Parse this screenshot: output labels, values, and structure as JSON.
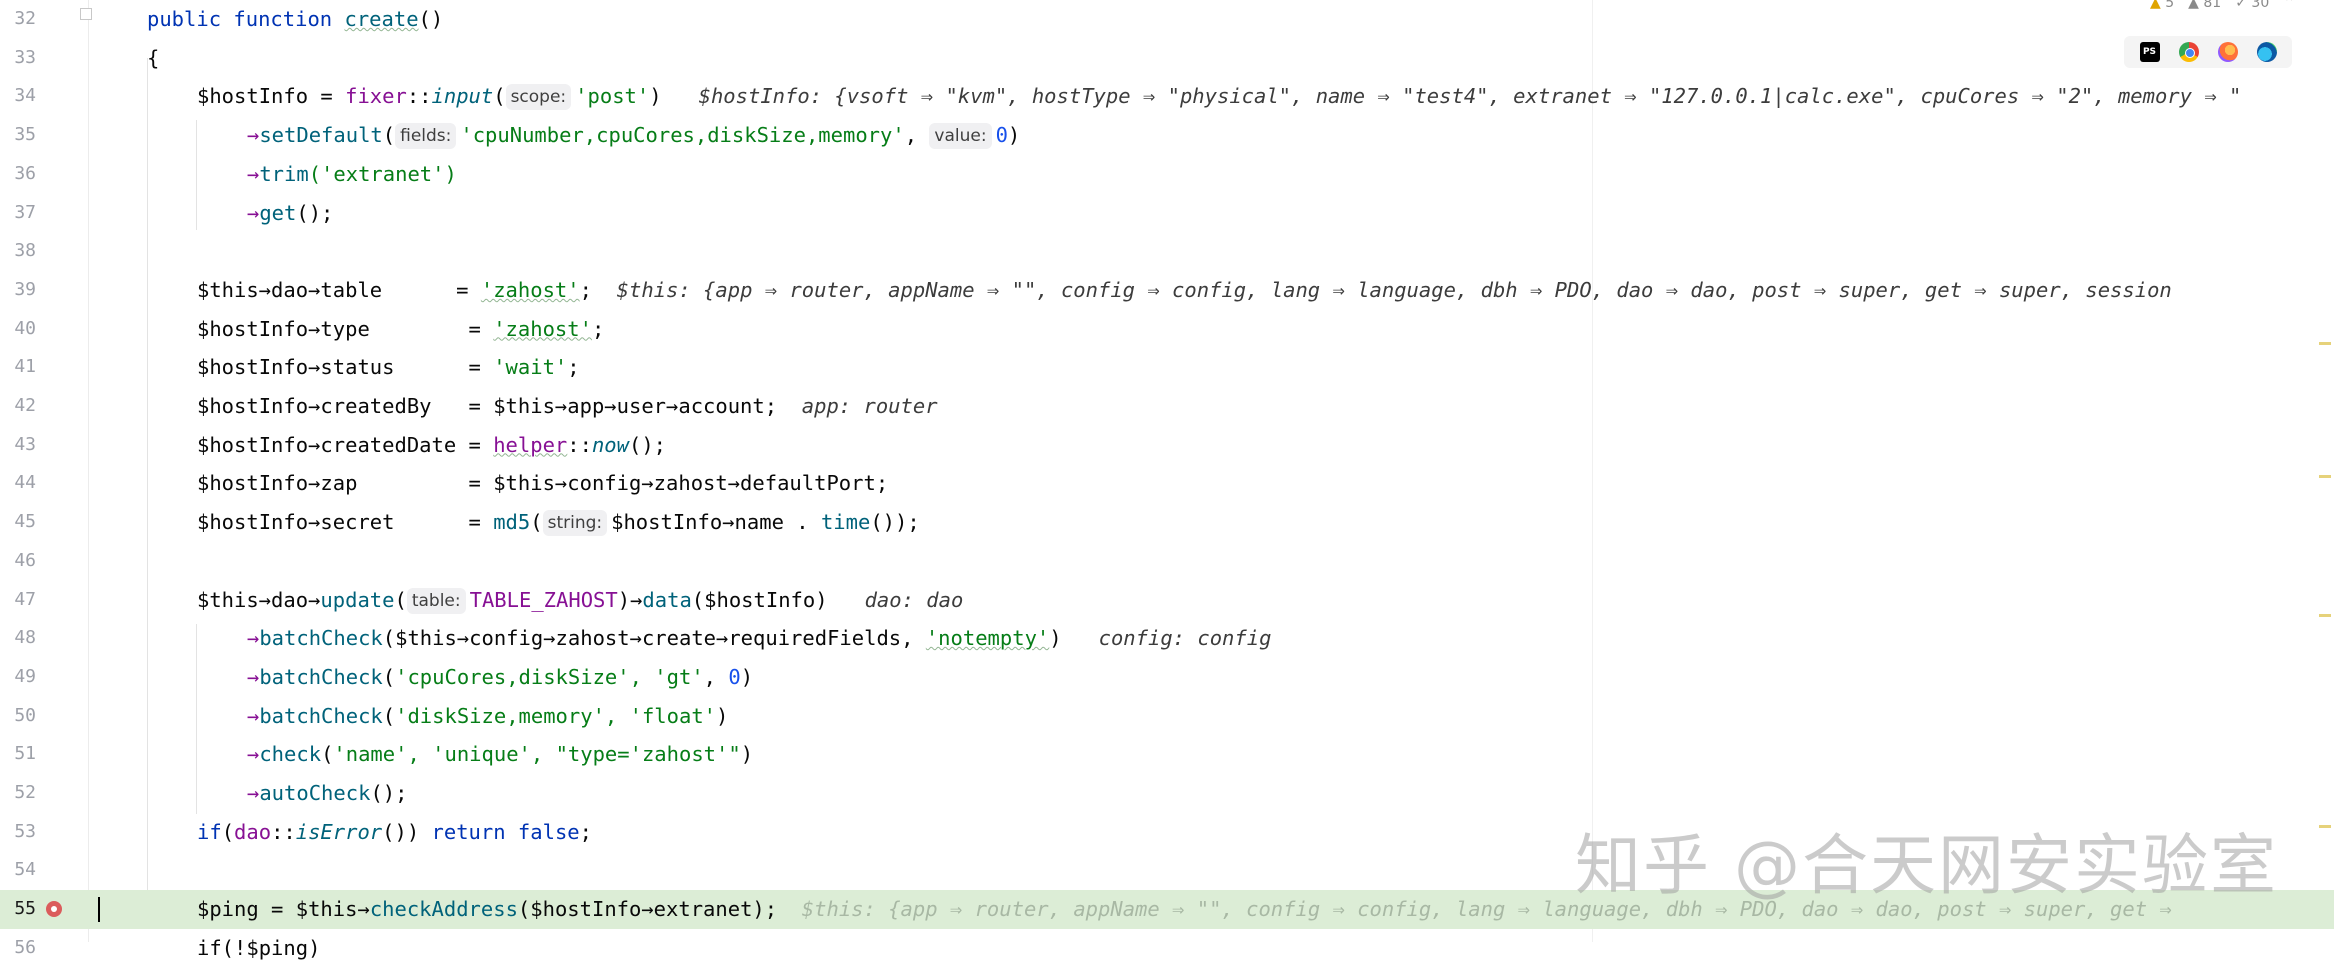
{
  "editor": {
    "lines": [
      {
        "n": "32"
      },
      {
        "n": "33"
      },
      {
        "n": "34"
      },
      {
        "n": "35"
      },
      {
        "n": "36"
      },
      {
        "n": "37"
      },
      {
        "n": "38"
      },
      {
        "n": "39"
      },
      {
        "n": "40"
      },
      {
        "n": "41"
      },
      {
        "n": "42"
      },
      {
        "n": "43"
      },
      {
        "n": "44"
      },
      {
        "n": "45"
      },
      {
        "n": "46"
      },
      {
        "n": "47"
      },
      {
        "n": "48"
      },
      {
        "n": "49"
      },
      {
        "n": "50"
      },
      {
        "n": "51"
      },
      {
        "n": "52"
      },
      {
        "n": "53"
      },
      {
        "n": "54"
      },
      {
        "n": "55"
      },
      {
        "n": "56"
      }
    ],
    "current_line": "55",
    "breakpoint_line": "55"
  },
  "inspections": {
    "warnings": "5",
    "weak_warnings": "81",
    "typos": "30"
  },
  "browser_icons": [
    "phpstorm-icon",
    "chrome-icon",
    "firefox-icon",
    "edge-icon"
  ],
  "code": {
    "l32": {
      "kw": "public function ",
      "fn": "create",
      "tail": "()"
    },
    "l33": {
      "text": "{"
    },
    "l34": {
      "var": "$hostInfo = ",
      "cls": "fixer",
      "sep": "::",
      "method": "input",
      "open": "(",
      "hint_label": "scope:",
      "arg": "'post'",
      "close": ")",
      "debug": "$hostInfo: {vsoft ⇒ \"kvm\", hostType ⇒ \"physical\", name ⇒ \"test4\", extranet ⇒ \"127.0.0.1|calc.exe\", cpuCores ⇒ \"2\", memory ⇒ \""
    },
    "l35": {
      "arrow": "→",
      "method": "setDefault",
      "open": "(",
      "hint_label": "fields:",
      "arg": "'cpuNumber,cpuCores,diskSize,memory'",
      "comma": ", ",
      "hint_label2": "value:",
      "arg2": "0",
      "close": ")"
    },
    "l36": {
      "arrow": "→",
      "method": "trim",
      "args": "('extranet')"
    },
    "l37": {
      "arrow": "→",
      "method": "get",
      "args": "();"
    },
    "l39": {
      "lhs": "$this→dao→table      = ",
      "str": "'zahost'",
      "semi": ";",
      "debug": "$this: {app ⇒ router, appName ⇒ \"\", config ⇒ config, lang ⇒ language, dbh ⇒ PDO, dao ⇒ dao, post ⇒ super, get ⇒ super, session"
    },
    "l40": {
      "lhs": "$hostInfo→type        = ",
      "str": "'zahost'",
      "semi": ";"
    },
    "l41": {
      "lhs": "$hostInfo→status      = ",
      "str": "'wait'",
      "semi": ";"
    },
    "l42": {
      "lhs": "$hostInfo→createdBy   = ",
      "rhs": "$this→app→user→account;",
      "debug": "app: router"
    },
    "l43": {
      "lhs": "$hostInfo→createdDate = ",
      "cls": "helper",
      "sep": "::",
      "method": "now",
      "tail": "();"
    },
    "l44": {
      "lhs": "$hostInfo→zap         = ",
      "rhs": "$this→config→zahost→defaultPort;"
    },
    "l45": {
      "lhs": "$hostInfo→secret      = ",
      "fn": "md5",
      "open": "(",
      "hint_label": "string:",
      "arg": "$hostInfo→name . ",
      "fn2": "time",
      "tail": "());"
    },
    "l47": {
      "head": "$this→dao→",
      "method": "update",
      "open": "(",
      "hint_label": "table:",
      "const": "TABLE_ZAHOST",
      "mid": ")→",
      "method2": "data",
      "tail": "($hostInfo)",
      "debug": "dao: dao"
    },
    "l48": {
      "arrow": "→",
      "method": "batchCheck",
      "args_pre": "($this→config→zahost→create→requiredFields, ",
      "str": "'notempty'",
      "close": ")",
      "debug": "config: config"
    },
    "l49": {
      "arrow": "→",
      "method": "batchCheck",
      "args_pre": "(",
      "str": "'cpuCores,diskSize', 'gt'",
      "comma": ", ",
      "num": "0",
      "close": ")"
    },
    "l50": {
      "arrow": "→",
      "method": "batchCheck",
      "args_pre": "(",
      "str": "'diskSize,memory', 'float'",
      "close": ")"
    },
    "l51": {
      "arrow": "→",
      "method": "check",
      "args_pre": "(",
      "str": "'name', 'unique', \"type='zahost'\"",
      "close": ")"
    },
    "l52": {
      "arrow": "→",
      "method": "autoCheck",
      "args": "();"
    },
    "l53": {
      "kw": "if",
      "mid": "(",
      "cls": "dao",
      "sep": "::",
      "method": "isError",
      "tail": "()) ",
      "kw2": "return false",
      "semi": ";"
    },
    "l55": {
      "lhs": "$ping = ",
      "rhs_head": "$this→",
      "method": "checkAddress",
      "tail": "($hostInfo→extranet);",
      "debug": "$this: {app ⇒ router, appName ⇒ \"\", config ⇒ config, lang ⇒ language, dbh ⇒ PDO, dao ⇒ dao, post ⇒ super, get ⇒"
    },
    "l56": {
      "text": "if(!$ping)"
    }
  },
  "watermark": "知乎 @合天网安实验室"
}
